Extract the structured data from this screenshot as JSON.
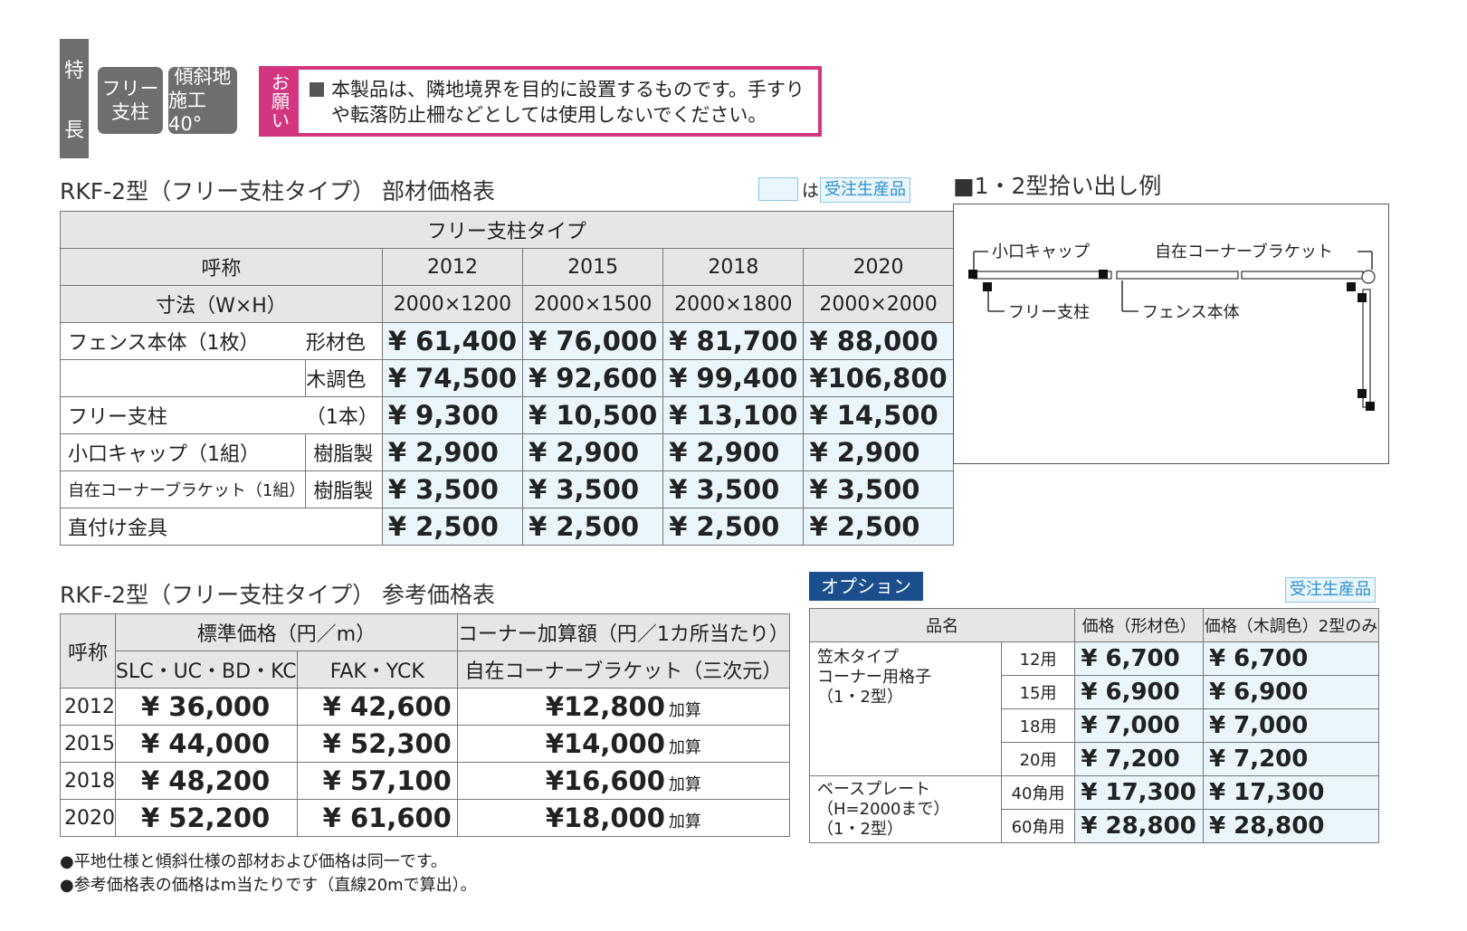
{
  "badges": {
    "feature_top": "特",
    "feature_bottom": "長",
    "free_post": [
      "フリー",
      "支柱"
    ],
    "slope": [
      "傾斜地",
      "施工40°"
    ]
  },
  "notice": {
    "label": [
      "お",
      "願",
      "い"
    ],
    "text_line1": "本製品は、隣地境界を目的に設置するものです。手すり",
    "text_line2": "や転落防止柵などとしては使用しないでください。"
  },
  "legend": {
    "ha": "は",
    "made_to_order": "受注生産品"
  },
  "parts_table": {
    "title": "RKF-2型（フリー支柱タイプ） 部材価格表",
    "type_header": "フリー支柱タイプ",
    "name_header": "呼称",
    "sizes": [
      "2012",
      "2015",
      "2018",
      "2020"
    ],
    "dimension_label": "寸法（W×H）",
    "dimensions": [
      "2000×1200",
      "2000×1500",
      "2000×1800",
      "2000×2000"
    ],
    "rows": [
      {
        "name": "フェンス本体（1枚）",
        "sub": "形材色",
        "prices": [
          "¥ 61,400",
          "¥ 76,000",
          "¥ 81,700",
          "¥ 88,000"
        ],
        "highlight": true
      },
      {
        "name": "",
        "sub": "木調色",
        "prices": [
          "¥ 74,500",
          "¥ 92,600",
          "¥ 99,400",
          "¥106,800"
        ],
        "highlight": true
      },
      {
        "name": "フリー支柱",
        "sub": "（1本）",
        "prices": [
          "¥ 9,300",
          "¥ 10,500",
          "¥ 13,100",
          "¥ 14,500"
        ],
        "highlight": true
      },
      {
        "name": "小口キャップ（1組）",
        "sub": "樹脂製",
        "prices": [
          "¥ 2,900",
          "¥ 2,900",
          "¥ 2,900",
          "¥ 2,900"
        ],
        "highlight": true
      },
      {
        "name": "自在コーナーブラケット（1組）",
        "sub": "樹脂製",
        "prices": [
          "¥ 3,500",
          "¥ 3,500",
          "¥ 3,500",
          "¥ 3,500"
        ],
        "highlight": true
      },
      {
        "name": "直付け金具",
        "sub": "",
        "prices": [
          "¥ 2,500",
          "¥ 2,500",
          "¥ 2,500",
          "¥ 2,500"
        ],
        "highlight": true
      }
    ]
  },
  "diagram": {
    "title": "■1・2型拾い出し例",
    "cap": "小口キャップ",
    "bracket": "自在コーナーブラケット",
    "post": "フリー支柱",
    "body": "フェンス本体"
  },
  "ref_table": {
    "title": "RKF-2型（フリー支柱タイプ） 参考価格表",
    "name_header": "呼称",
    "std_header": "標準価格（円／m）",
    "corner_header": "コーナー加算額（円／1カ所当たり）",
    "col1": "SLC・UC・BD・KC",
    "col2": "FAK・YCK",
    "col3": "自在コーナーブラケット（三次元）",
    "kasan": "加算",
    "rows": [
      {
        "size": "2012",
        "p1": "¥ 36,000",
        "p2": "¥ 42,600",
        "p3": "¥12,800"
      },
      {
        "size": "2015",
        "p1": "¥ 44,000",
        "p2": "¥ 52,300",
        "p3": "¥14,000"
      },
      {
        "size": "2018",
        "p1": "¥ 48,200",
        "p2": "¥ 57,100",
        "p3": "¥16,600"
      },
      {
        "size": "2020",
        "p1": "¥ 52,200",
        "p2": "¥ 61,600",
        "p3": "¥18,000"
      }
    ]
  },
  "notes": [
    "●平地仕様と傾斜仕様の部材および価格は同一です。",
    "●参考価格表の価格はm当たりです（直線20mで算出）。"
  ],
  "option": {
    "label": "オプション",
    "made_to_order": "受注生産品",
    "h_name": "品名",
    "h_price1": "価格（形材色）",
    "h_price2": "価格（木調色）2型のみ",
    "group1": [
      "笠木タイプ",
      "コーナー用格子",
      "（1・2型）"
    ],
    "group2": [
      "ベースプレート",
      "（H=2000まで）",
      "（1・2型）"
    ],
    "rows": [
      {
        "spec": "12用",
        "p1": "¥ 6,700",
        "p2": "¥ 6,700"
      },
      {
        "spec": "15用",
        "p1": "¥ 6,900",
        "p2": "¥ 6,900"
      },
      {
        "spec": "18用",
        "p1": "¥ 7,000",
        "p2": "¥ 7,000"
      },
      {
        "spec": "20用",
        "p1": "¥ 7,200",
        "p2": "¥ 7,200"
      },
      {
        "spec": "40角用",
        "p1": "¥ 17,300",
        "p2": "¥ 17,300"
      },
      {
        "spec": "60角用",
        "p1": "¥ 28,800",
        "p2": "¥ 28,800"
      }
    ]
  }
}
